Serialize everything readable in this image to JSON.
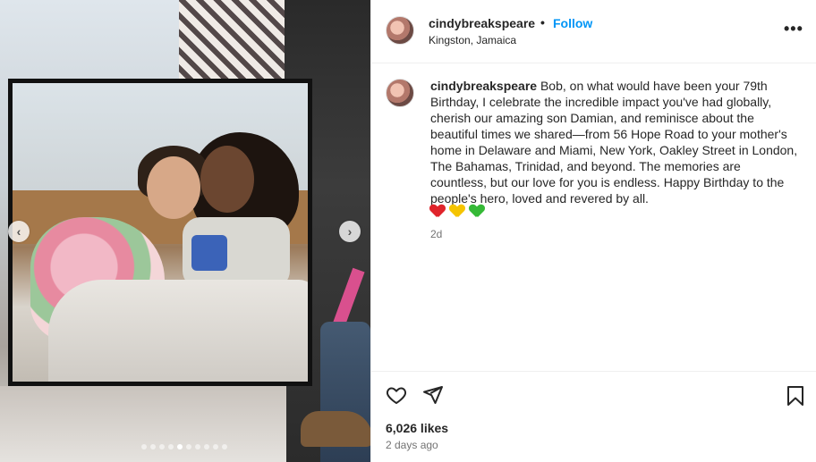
{
  "post": {
    "media": {
      "carousel": {
        "total": 10,
        "active_index": 4
      }
    },
    "header": {
      "username": "cindybreakspeare",
      "separator": "•",
      "follow_label": "Follow",
      "location": "Kingston, Jamaica",
      "more_icon": "more-options-icon"
    },
    "caption": {
      "username": "cindybreakspeare",
      "text": "Bob, on what would have been your 79th Birthday, I celebrate the incredible impact you've had globally, cherish our amazing son Damian, and reminisce about the beautiful times we shared—from 56 Hope Road to your mother's home in Delaware and Miami, New York, Oakley Street in London, The Bahamas, Trinidad, and beyond. The memories are countless, but our love for you is endless. Happy Birthday to the people's hero, loved and revered by all.",
      "emojis": [
        "red-heart",
        "yellow-heart",
        "green-heart"
      ],
      "time": "2d"
    },
    "actions": {
      "like_icon": "heart-outline-icon",
      "share_icon": "paper-plane-icon",
      "save_icon": "bookmark-icon"
    },
    "likes": "6,026 likes",
    "posted_ago": "2 days ago"
  },
  "colors": {
    "follow": "#0095f6",
    "text": "#262626",
    "muted": "#737373",
    "divider": "#efefef"
  }
}
